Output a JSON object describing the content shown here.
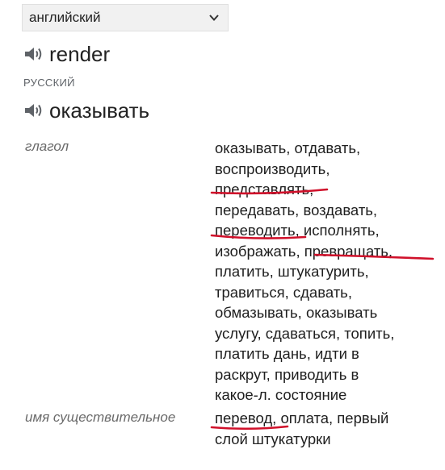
{
  "source_language_select": {
    "value": "английский"
  },
  "source": {
    "word": "render"
  },
  "target": {
    "language_label": "РУССКИЙ",
    "word": "оказывать"
  },
  "entries": [
    {
      "part_of_speech": "глагол",
      "lines": [
        "оказывать, отдавать,",
        "воспроизводить,",
        "представлять,",
        "передавать, воздавать,",
        "переводить, исполнять,",
        "изображать, превращать,",
        "платить, штукатурить,",
        "травиться, сдавать,",
        "обмазывать, оказывать",
        "услугу, сдаваться, топить,",
        "платить дань, идти в",
        "раскрут, приводить в",
        "какое-л. состояние"
      ]
    },
    {
      "part_of_speech": "имя существительное",
      "lines": [
        "перевод, оплата, первый",
        "слой штукатурки"
      ]
    }
  ],
  "annotation_color": "#d0112b",
  "icons": {
    "speaker": "speaker-icon",
    "dropdown": "chevron-down-icon"
  }
}
